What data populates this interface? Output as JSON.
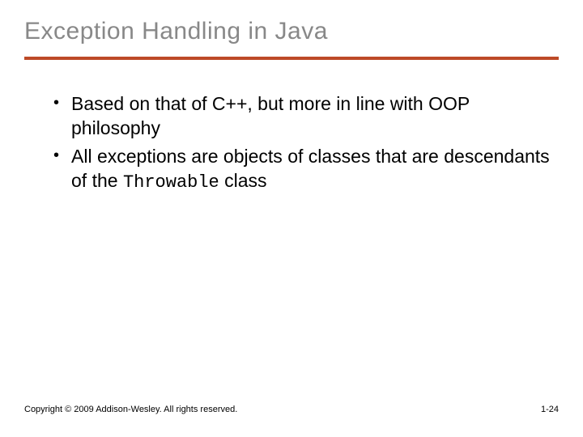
{
  "title": "Exception Handling in Java",
  "bullets": [
    {
      "pre": "Based on that of C++, but more in line with OOP philosophy",
      "code": "",
      "post": ""
    },
    {
      "pre": "All exceptions are objects of classes that are descendants of the ",
      "code": "Throwable",
      "post": " class"
    }
  ],
  "footer": {
    "copyright": "Copyright © 2009 Addison-Wesley. All rights reserved.",
    "pagenum": "1-24"
  }
}
